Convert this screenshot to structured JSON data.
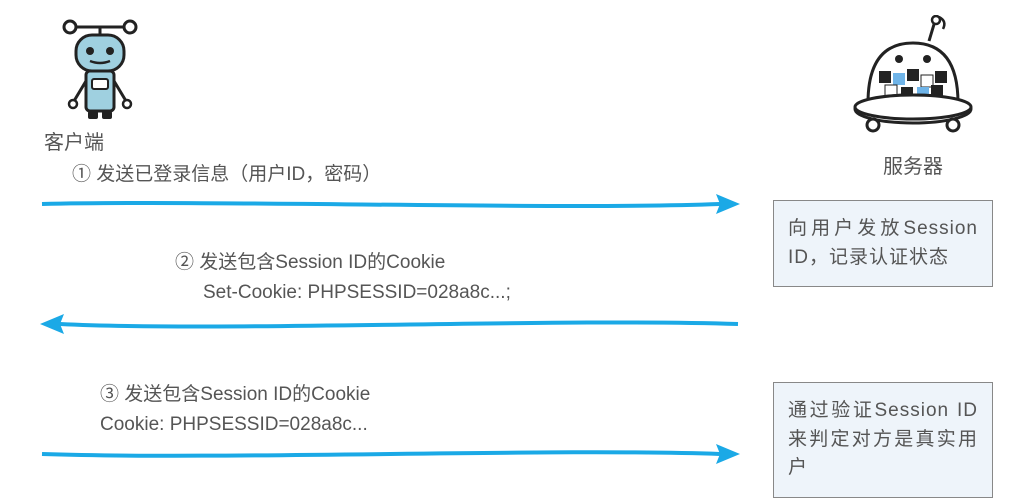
{
  "client": {
    "label": "客户端"
  },
  "server": {
    "label": "服务器"
  },
  "messages": {
    "m1": {
      "text": "① 发送已登录信息（用户ID，密码）"
    },
    "m2": {
      "line1": "② 发送包含Session ID的Cookie",
      "line2": "Set-Cookie: PHPSESSID=028a8c...;"
    },
    "m3": {
      "line1": "③ 发送包含Session ID的Cookie",
      "line2": "Cookie: PHPSESSID=028a8c..."
    }
  },
  "boxes": {
    "b1": "向用户发放Session ID，记录认证状态",
    "b2": "通过验证Session ID来判定对方是真实用户"
  }
}
